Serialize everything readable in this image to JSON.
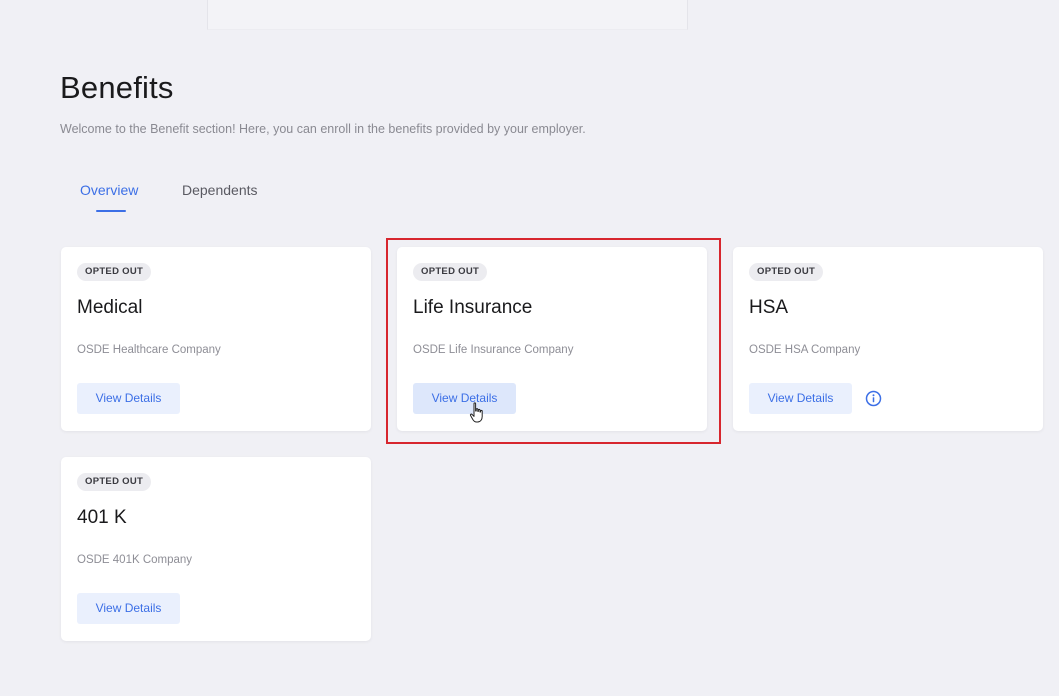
{
  "page": {
    "title": "Benefits",
    "subtitle": "Welcome to the Benefit section! Here, you can enroll in the benefits provided by your employer."
  },
  "tabs": [
    {
      "label": "Overview",
      "active": true
    },
    {
      "label": "Dependents",
      "active": false
    }
  ],
  "cards": [
    {
      "status": "OPTED OUT",
      "title": "Medical",
      "company": "OSDE Healthcare Company",
      "button": "View Details"
    },
    {
      "status": "OPTED OUT",
      "title": "Life Insurance",
      "company": "OSDE Life Insurance Company",
      "button": "View Details"
    },
    {
      "status": "OPTED OUT",
      "title": "HSA",
      "company": "OSDE HSA Company",
      "button": "View Details",
      "icon": "info-icon"
    },
    {
      "status": "OPTED OUT",
      "title": "401 K",
      "company": "OSDE 401K Company",
      "button": "View Details"
    }
  ],
  "colors": {
    "accent": "#3c6fe6",
    "highlight": "#d7262e",
    "background": "#f0f0f5"
  }
}
